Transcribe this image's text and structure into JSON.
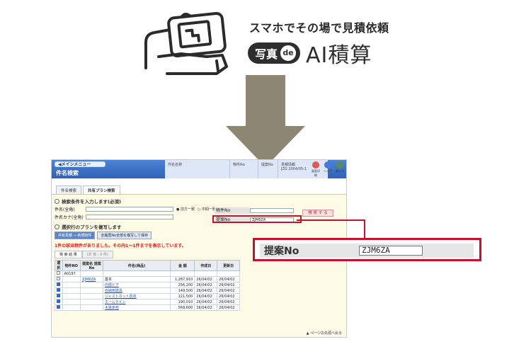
{
  "hero": {
    "tagline": "スマホでその場で見積依頼",
    "badge_text": "写真",
    "badge_de": "de",
    "product": "AI積算"
  },
  "colors": {
    "accent_red": "#c8102e",
    "arrow": "#8c8672",
    "header_blue": "#2f62b8"
  },
  "app": {
    "menu_button": "◀メインメニュー",
    "title": "件名検索",
    "header_columns": [
      "件名名称",
      "物件No",
      "提案No",
      "見積情報"
    ],
    "header_info": "JZG",
    "header_sub": "2004/05-1",
    "header_icons": [
      {
        "name": "print-icon",
        "label": "画面印刷"
      },
      {
        "name": "help-icon",
        "label": "ヘルプ"
      },
      {
        "name": "close-icon",
        "label": "閉じる"
      }
    ],
    "tabs": [
      "件名検索",
      "共有プラン検索"
    ],
    "section1": "検索条件を入力します(必須)",
    "fields": {
      "name_label": "件名(全角)",
      "kana_label": "件名カナ(全角)",
      "radio1": "● 前方一致",
      "radio2": "○ 中間一致",
      "property_label": "物件No",
      "proposal_label": "提案No",
      "proposal_value": "ZJM6ZA"
    },
    "search_button": "検 索 す る",
    "section2": "選択行のプランを複写します",
    "plan_buttons": [
      "共有見積 → 新規物件",
      "全履歴No全部を複写して保存"
    ],
    "result_message": "1件の該当物件がありました。その内1〜1件までを表示しています。",
    "result_tabs": [
      "検 索 結 果",
      "(対 象 : 0 件)"
    ],
    "table_headers": [
      "選択",
      "物件NO",
      "提案名 提案No",
      "件名(商品)",
      "金 額",
      "作成日",
      "更新日"
    ],
    "rows": [
      {
        "checked": false,
        "no": "A0197",
        "code": "",
        "name": "",
        "amount": "",
        "created": "",
        "updated": ""
      },
      {
        "checked": false,
        "no": "",
        "code": "ZJM6ZA",
        "name": "基本",
        "amount": "1,287,910",
        "created": "26/04/02",
        "updated": "26/04/02"
      },
      {
        "checked": true,
        "no": "",
        "code": "",
        "name": "内部ドア",
        "amount": "256,200",
        "created": "26/04/02",
        "updated": "26/04/02"
      },
      {
        "checked": true,
        "no": "",
        "code": "",
        "name": "収納用建具",
        "amount": "149,500",
        "created": "26/04/02",
        "updated": "26/04/02"
      },
      {
        "checked": true,
        "no": "",
        "code": "",
        "name": "ジャストカット回収",
        "amount": "121,500",
        "created": "26/04/02",
        "updated": "26/04/02"
      },
      {
        "checked": true,
        "no": "",
        "code": "",
        "name": "ホームライン",
        "amount": "190,010",
        "created": "26/04/02",
        "updated": "26/04/02"
      },
      {
        "checked": true,
        "no": "",
        "code": "",
        "name": "木質床材",
        "amount": "569,600",
        "created": "26/04/02",
        "updated": "26/04/02"
      }
    ],
    "page_top": "▲ ページの先頭へ戻る"
  },
  "zoom": {
    "label": "提案No",
    "value": "ZJM6ZA"
  }
}
